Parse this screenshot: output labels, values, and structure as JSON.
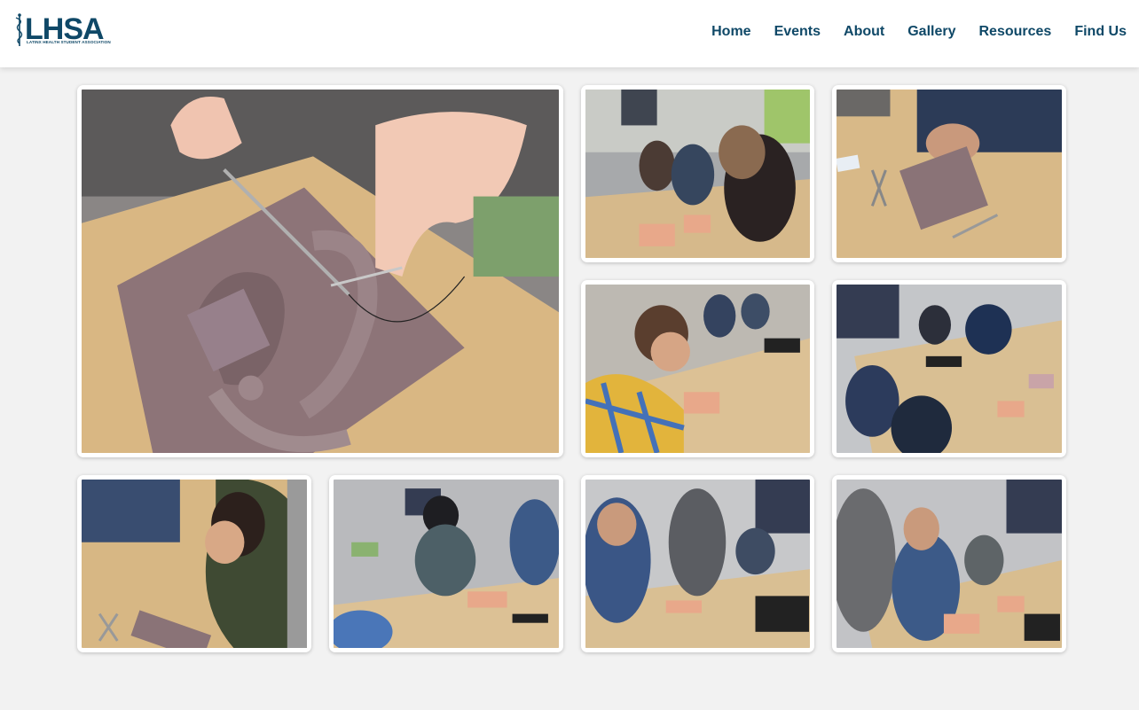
{
  "site": {
    "logo_text": "LHSA",
    "logo_subtitle": "LATINX HEALTH STUDENT ASSOCIATION"
  },
  "nav": {
    "items": [
      {
        "label": "Home"
      },
      {
        "label": "Events"
      },
      {
        "label": "About"
      },
      {
        "label": "Gallery"
      },
      {
        "label": "Resources"
      },
      {
        "label": "Find Us"
      }
    ]
  },
  "gallery": {
    "photos": [
      {
        "subject": "suture practice pad close-up with needle driver"
      },
      {
        "subject": "two students practicing suturing at table"
      },
      {
        "subject": "student suturing practice pad with instruments"
      },
      {
        "subject": "student in plaid shirt suturing"
      },
      {
        "subject": "group of students at suturing workshop table"
      },
      {
        "subject": "student smiling while suturing"
      },
      {
        "subject": "students in classroom suturing"
      },
      {
        "subject": "instructor helping students suture"
      },
      {
        "subject": "students suturing at table near computer"
      }
    ]
  },
  "colors": {
    "brand": "#0f4867",
    "background": "#f2f2f2",
    "tile": "#ffffff"
  }
}
